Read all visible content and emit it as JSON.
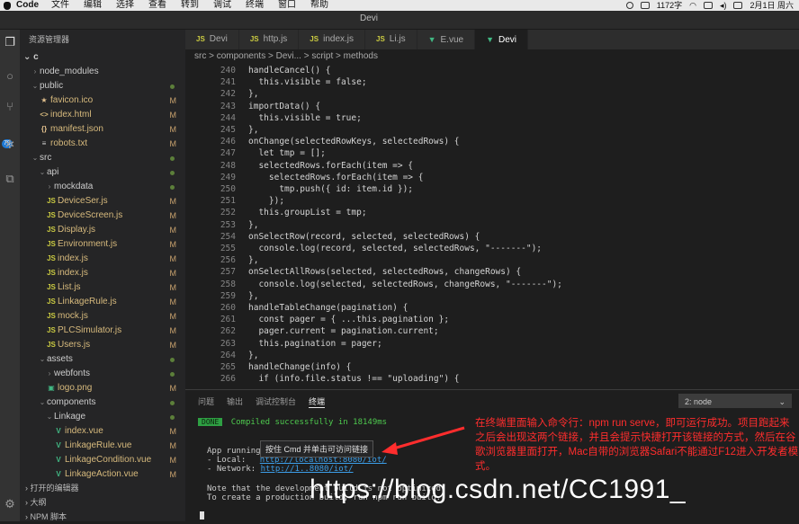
{
  "menubar": {
    "app": "Code",
    "items": [
      "文件",
      "编辑",
      "选择",
      "查看",
      "转到",
      "调试",
      "终端",
      "窗口",
      "帮助"
    ],
    "status_text": "1172字",
    "date_text": "2月1日 周六"
  },
  "window": {
    "title": "Devi"
  },
  "sidebar": {
    "header": "资源管理器",
    "root": "c",
    "items": [
      {
        "label": "node_modules",
        "kind": "folder",
        "depth": 1,
        "status": ""
      },
      {
        "label": "public",
        "kind": "folder",
        "depth": 1,
        "status": "dot"
      },
      {
        "label": "favicon.ico",
        "kind": "ico",
        "depth": 2,
        "status": "M"
      },
      {
        "label": "index.html",
        "kind": "html",
        "depth": 2,
        "status": "M"
      },
      {
        "label": "manifest.json",
        "kind": "json",
        "depth": 2,
        "status": "M"
      },
      {
        "label": "robots.txt",
        "kind": "txt",
        "depth": 2,
        "status": "M"
      },
      {
        "label": "src",
        "kind": "folder",
        "depth": 1,
        "status": "dot"
      },
      {
        "label": "api",
        "kind": "folder",
        "depth": 2,
        "status": "dot"
      },
      {
        "label": "mockdata",
        "kind": "folder",
        "depth": 3,
        "status": "dot"
      },
      {
        "label": "DeviceSer.js",
        "kind": "js",
        "depth": 3,
        "status": "M"
      },
      {
        "label": "DeviceScreen.js",
        "kind": "js",
        "depth": 3,
        "status": "M"
      },
      {
        "label": "Display.js",
        "kind": "js",
        "depth": 3,
        "status": "M"
      },
      {
        "label": "Environment.js",
        "kind": "js",
        "depth": 3,
        "status": "M"
      },
      {
        "label": "index.js",
        "kind": "js",
        "depth": 3,
        "status": "M"
      },
      {
        "label": "index.js",
        "kind": "js",
        "depth": 3,
        "status": "M"
      },
      {
        "label": "List.js",
        "kind": "js",
        "depth": 3,
        "status": "M"
      },
      {
        "label": "LinkageRule.js",
        "kind": "js",
        "depth": 3,
        "status": "M"
      },
      {
        "label": "mock.js",
        "kind": "js",
        "depth": 3,
        "status": "M"
      },
      {
        "label": "PLCSimulator.js",
        "kind": "js",
        "depth": 3,
        "status": "M"
      },
      {
        "label": "Users.js",
        "kind": "js",
        "depth": 3,
        "status": "M"
      },
      {
        "label": "assets",
        "kind": "folder",
        "depth": 2,
        "status": "dot"
      },
      {
        "label": "webfonts",
        "kind": "folder",
        "depth": 3,
        "status": "dot"
      },
      {
        "label": "logo.png",
        "kind": "img",
        "depth": 3,
        "status": "M"
      },
      {
        "label": "components",
        "kind": "folder",
        "depth": 2,
        "status": "dot"
      },
      {
        "label": "Linkage",
        "kind": "folder",
        "depth": 3,
        "status": "dot"
      },
      {
        "label": "index.vue",
        "kind": "vue",
        "depth": 4,
        "status": "M"
      },
      {
        "label": "LinkageRule.vue",
        "kind": "vue",
        "depth": 4,
        "status": "M"
      },
      {
        "label": "LinkageCondition.vue",
        "kind": "vue",
        "depth": 4,
        "status": "M"
      },
      {
        "label": "LinkageAction.vue",
        "kind": "vue",
        "depth": 4,
        "status": "M"
      }
    ],
    "footer": [
      "打开的编辑器",
      "大纲",
      "NPM 脚本"
    ]
  },
  "tabs": [
    {
      "label": "Devi",
      "icon": "JS",
      "active": false
    },
    {
      "label": "http.js",
      "icon": "JS",
      "active": false
    },
    {
      "label": "index.js",
      "icon": "JS",
      "active": false
    },
    {
      "label": "Li.js",
      "icon": "JS",
      "active": false
    },
    {
      "label": "E.vue",
      "icon": "V",
      "active": false
    },
    {
      "label": "Devi",
      "icon": "V",
      "active": true
    }
  ],
  "breadcrumb": "src > components > Devi... > script > methods",
  "editor": {
    "lines": [
      {
        "n": "240",
        "t": "handleCancel() {"
      },
      {
        "n": "241",
        "t": "  this.visible = false;"
      },
      {
        "n": "242",
        "t": "},"
      },
      {
        "n": "243",
        "t": "importData() {"
      },
      {
        "n": "244",
        "t": "  this.visible = true;"
      },
      {
        "n": "245",
        "t": "},"
      },
      {
        "n": "246",
        "t": "onChange(selectedRowKeys, selectedRows) {"
      },
      {
        "n": "247",
        "t": "  let tmp = [];"
      },
      {
        "n": "248",
        "t": "  selectedRows.forEach(item => {"
      },
      {
        "n": "249",
        "t": "    selectedRows.forEach(item => {"
      },
      {
        "n": "250",
        "t": "      tmp.push({ id: item.id });"
      },
      {
        "n": "251",
        "t": "    });"
      },
      {
        "n": "252",
        "t": "  this.groupList = tmp;"
      },
      {
        "n": "253",
        "t": "},"
      },
      {
        "n": "254",
        "t": "onSelectRow(record, selected, selectedRows) {"
      },
      {
        "n": "255",
        "t": "  console.log(record, selected, selectedRows, \"-------\");"
      },
      {
        "n": "256",
        "t": "},"
      },
      {
        "n": "257",
        "t": "onSelectAllRows(selected, selectedRows, changeRows) {"
      },
      {
        "n": "258",
        "t": "  console.log(selected, selectedRows, changeRows, \"-------\");"
      },
      {
        "n": "259",
        "t": "},"
      },
      {
        "n": "260",
        "t": "handleTableChange(pagination) {"
      },
      {
        "n": "261",
        "t": "  const pager = { ...this.pagination };"
      },
      {
        "n": "262",
        "t": "  pager.current = pagination.current;"
      },
      {
        "n": "263",
        "t": "  this.pagination = pager;"
      },
      {
        "n": "264",
        "t": "},"
      },
      {
        "n": "265",
        "t": "handleChange(info) {"
      },
      {
        "n": "266",
        "t": "  if (info.file.status !== \"uploading\") {"
      }
    ]
  },
  "panel": {
    "tabs": [
      "问题",
      "输出",
      "调试控制台",
      "终端"
    ],
    "selected": "2: node",
    "done_badge": "DONE",
    "compiled": "Compiled successfully in 18149ms",
    "app_running": "App running at:",
    "local_label": "- Local:",
    "local_url": "http://localhost:8080/iot/",
    "network_label": "- Network:",
    "network_url": "http://1..8080/iot/",
    "note1": "Note that the development build is not optimized.",
    "note2": "To create a production build, run npm run build."
  },
  "tooltip": "按住 Cmd 并单击可访问链接",
  "annotation": "在终端里面输入命令行：npm run serve，即可运行成功。项目跑起来之后会出现这两个链接，并且会提示快捷打开该链接的方式，然后在谷歌浏览器里面打开，Mac自带的浏览器Safari不能通过F12进入开发者模式。",
  "watermark": "https://blog.csdn.net/CC1991_"
}
